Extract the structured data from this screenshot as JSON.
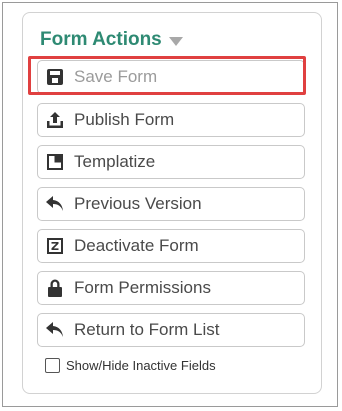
{
  "panel": {
    "title": "Form Actions",
    "buttons": [
      {
        "label": "Save Form",
        "icon": "save-icon",
        "state": "disabled"
      },
      {
        "label": "Publish Form",
        "icon": "upload-icon",
        "state": "enabled"
      },
      {
        "label": "Templatize",
        "icon": "template-icon",
        "state": "enabled"
      },
      {
        "label": "Previous Version",
        "icon": "undo-arrow-icon",
        "state": "enabled"
      },
      {
        "label": "Deactivate Form",
        "icon": "z-box-icon",
        "state": "enabled"
      },
      {
        "label": "Form Permissions",
        "icon": "lock-icon",
        "state": "enabled"
      },
      {
        "label": "Return to Form List",
        "icon": "return-arrow-icon",
        "state": "enabled"
      }
    ],
    "show_hide_inactive": {
      "label": "Show/Hide Inactive Fields",
      "checked": false
    }
  },
  "colors": {
    "title": "#2e8a73",
    "highlight": "#e04040",
    "icon": "#333333"
  }
}
